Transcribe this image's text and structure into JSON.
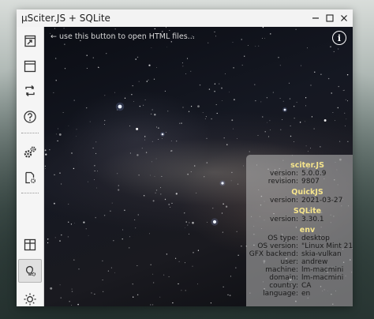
{
  "window": {
    "title": "µSciter.JS + SQLite",
    "controls": {
      "minimize": "—",
      "maximize": "☐",
      "close": "✕"
    }
  },
  "sidebar": {
    "items": [
      {
        "icon": "open-html-icon"
      },
      {
        "icon": "window-icon"
      },
      {
        "icon": "refresh-icon"
      },
      {
        "icon": "help-icon"
      },
      {
        "icon": "gears-icon"
      },
      {
        "icon": "document-settings-icon"
      },
      {
        "icon": "grid-icon"
      },
      {
        "icon": "lightbulb-icon"
      },
      {
        "icon": "sun-icon"
      }
    ]
  },
  "content": {
    "hint": "← use this button to open HTML files...",
    "info_glyph": "i"
  },
  "panel": {
    "sciter": {
      "title": "sciter.JS",
      "rows": [
        {
          "key": "version:",
          "value": "5.0.0.9"
        },
        {
          "key": "revision:",
          "value": "9807"
        }
      ]
    },
    "quickjs": {
      "title": "QuickJS",
      "rows": [
        {
          "key": "version:",
          "value": "2021-03-27"
        }
      ]
    },
    "sqlite": {
      "title": "SQLite",
      "rows": [
        {
          "key": "version:",
          "value": "3.30.1"
        }
      ]
    },
    "env": {
      "title": "env",
      "rows": [
        {
          "key": "OS type:",
          "value": "desktop"
        },
        {
          "key": "OS version:",
          "value": "\"Linux Mint 21\""
        },
        {
          "key": "GFX backend:",
          "value": "skia-vulkan"
        },
        {
          "key": "user:",
          "value": "andrew"
        },
        {
          "key": "machine:",
          "value": "lm-macmini"
        },
        {
          "key": "domain:",
          "value": "lm-macmini"
        },
        {
          "key": "country:",
          "value": "CA"
        },
        {
          "key": "language:",
          "value": "en"
        }
      ]
    }
  }
}
